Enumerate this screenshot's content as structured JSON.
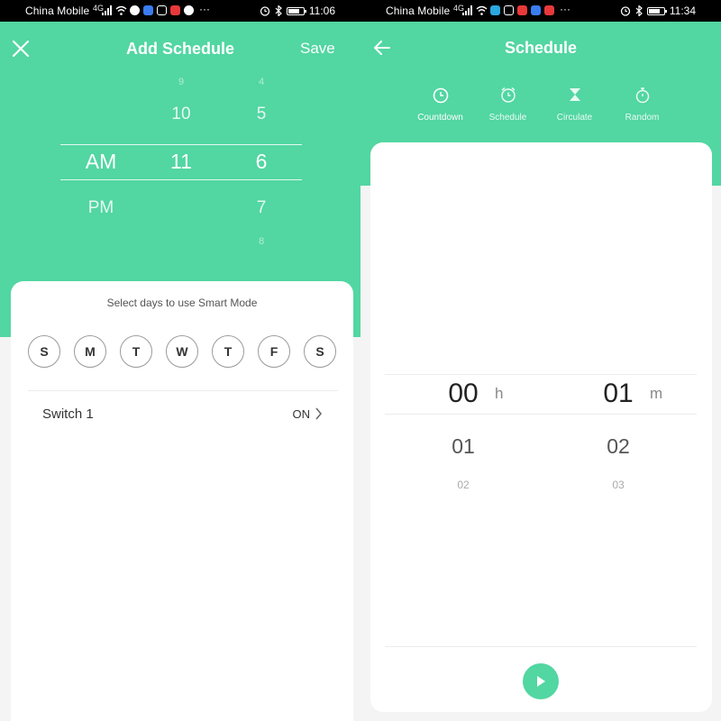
{
  "status_bars": [
    {
      "carrier": "China Mobile",
      "network": "4G",
      "time": "11:06"
    },
    {
      "carrier": "China Mobile",
      "network": "4G",
      "time": "11:34"
    }
  ],
  "add_schedule": {
    "close_icon": "close-icon",
    "title": "Add Schedule",
    "save_label": "Save",
    "picker": {
      "ampm": {
        "above": "",
        "selected": "AM",
        "below": "PM"
      },
      "hour": {
        "far_above": "9",
        "above": "10",
        "selected": "11",
        "below": ""
      },
      "minute": {
        "far_above": "4",
        "above": "5",
        "selected": "6",
        "below": "7",
        "far_below": "8"
      }
    },
    "days_prompt": "Select days to use Smart Mode",
    "days": [
      "S",
      "M",
      "T",
      "W",
      "T",
      "F",
      "S"
    ],
    "switch_row": {
      "label": "Switch 1",
      "value": "ON"
    }
  },
  "schedule": {
    "back_icon": "back-arrow-icon",
    "title": "Schedule",
    "tabs": [
      {
        "label": "Countdown",
        "icon": "clock-icon",
        "active": true
      },
      {
        "label": "Schedule",
        "icon": "alarm-clock-icon",
        "active": false
      },
      {
        "label": "Circulate",
        "icon": "hourglass-icon",
        "active": false
      },
      {
        "label": "Random",
        "icon": "stopwatch-icon",
        "active": false
      }
    ],
    "countdown": {
      "hours": {
        "selected": "00",
        "next": "01",
        "next2": "02",
        "unit": "h"
      },
      "minutes": {
        "selected": "01",
        "next": "02",
        "next2": "03",
        "unit": "m"
      }
    },
    "play_icon": "play-icon"
  },
  "colors": {
    "accent": "#52d6a2",
    "status_bar": "#000000",
    "background": "#f4f4f4",
    "card": "#ffffff"
  }
}
